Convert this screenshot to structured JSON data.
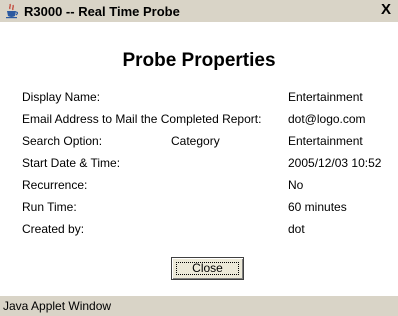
{
  "window": {
    "title": "R3000 -- Real Time Probe",
    "close_glyph": "X",
    "title_icon": "java-cup-icon"
  },
  "heading": "Probe Properties",
  "properties": [
    {
      "label": "Display Name:",
      "middle": "",
      "value": "Entertainment"
    },
    {
      "label": "Email Address to Mail the Completed Report:",
      "middle": "",
      "value": "dot@logo.com"
    },
    {
      "label": "Search Option:",
      "middle": "Category",
      "value": "Entertainment"
    },
    {
      "label": "Start Date & Time:",
      "middle": "",
      "value": "2005/12/03 10:52"
    },
    {
      "label": "Recurrence:",
      "middle": "",
      "value": "No"
    },
    {
      "label": "Run Time:",
      "middle": "",
      "value": "60 minutes"
    },
    {
      "label": "Created by:",
      "middle": "",
      "value": "dot"
    }
  ],
  "buttons": {
    "close_label": "Close"
  },
  "status_bar": {
    "text": "Java Applet Window"
  },
  "colors": {
    "titlebar_bg": "#d9d4c7",
    "button_bg": "#ece9d8",
    "background": "#ffffff"
  }
}
